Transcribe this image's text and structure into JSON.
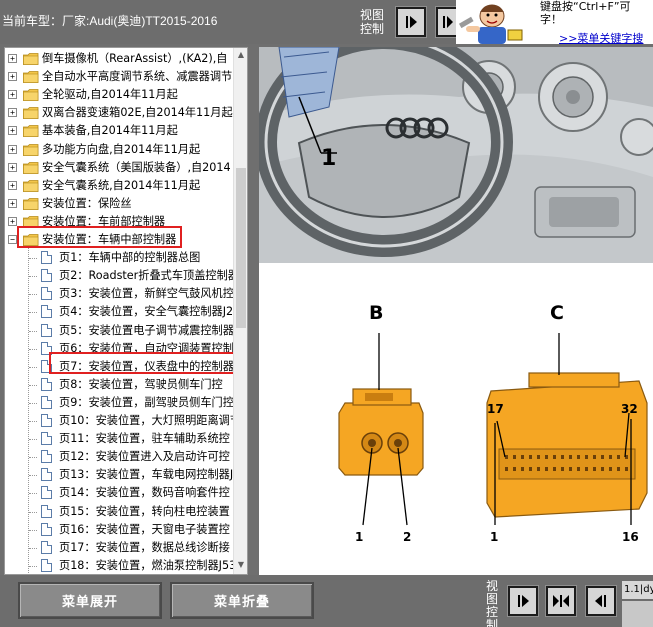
{
  "header": {
    "car_label": "当前车型：厂家:Audi(奥迪)TT2015-2016",
    "view_control_top": "视图控制",
    "tip_text": "键盘按“Ctrl+F”可 字！",
    "tip_link": ">>菜单关键字搜"
  },
  "tree": {
    "rows": [
      {
        "label": "倒车摄像机（RearAssist）,(KA2),自"
      },
      {
        "label": "全自动水平高度调节系统、减震器调节"
      },
      {
        "label": "全轮驱动,自2014年11月起"
      },
      {
        "label": "双离合器变速箱02E,自2014年11月起"
      },
      {
        "label": "基本装备,自2014年11月起"
      },
      {
        "label": "多功能方向盘,自2014年11月起"
      },
      {
        "label": "安全气囊系统（美国版装备）,自2014"
      },
      {
        "label": "安全气囊系统,自2014年11月起"
      },
      {
        "label": "安装位置：保险丝"
      },
      {
        "label": "安装位置：车前部控制器"
      },
      {
        "label": "安装位置：车辆中部控制器"
      }
    ],
    "pages": [
      {
        "label": "页1：车辆中部的控制器总图"
      },
      {
        "label": "页2：Roadster折叠式车顶盖控制器"
      },
      {
        "label": "页3：安装位置，新鲜空气鼓风机控"
      },
      {
        "label": "页4：安装位置，安全气囊控制器J2"
      },
      {
        "label": "页5：安装位置电子调节减震控制器"
      },
      {
        "label": "页6：安装位置，自动空调装置控制"
      },
      {
        "label": "页7：安装位置，仪表盘中的控制器"
      },
      {
        "label": "页8：安装位置，驾驶员侧车门控"
      },
      {
        "label": "页9：安装位置，副驾驶员侧车门控"
      },
      {
        "label": "页10：安装位置，大灯照明距离调节"
      },
      {
        "label": "页11：安装位置，驻车辅助系统控"
      },
      {
        "label": "页12：安装位置进入及启动许可控"
      },
      {
        "label": "页13：安装位置，车载电网控制器J5"
      },
      {
        "label": "页14：安装位置，数码音响套件控"
      },
      {
        "label": "页15：安装位置，转向柱电控装置"
      },
      {
        "label": "页16：安装位置，天窗电子装置控"
      },
      {
        "label": "页17：安装位置，数据总线诊断接"
      },
      {
        "label": "页18：安装位置，燃油泵控制器J53"
      }
    ]
  },
  "diagram": {
    "callout_photo": "1",
    "connector_b": "B",
    "connector_c": "C",
    "b_pin_left": "1",
    "b_pin_right": "2",
    "c_pin_top_left": "17",
    "c_pin_top_right": "32",
    "c_pin_bottom_left": "1",
    "c_pin_bottom_right": "16"
  },
  "footer": {
    "expand_menu": "菜单展开",
    "collapse_menu": "菜单折叠",
    "view_control_bottom": "视图控制",
    "version": "1.1|dy"
  },
  "colors": {
    "highlight": "#e02020",
    "connector": "#f5a623",
    "folder": "#f3c64a",
    "link": "#0000cc"
  }
}
